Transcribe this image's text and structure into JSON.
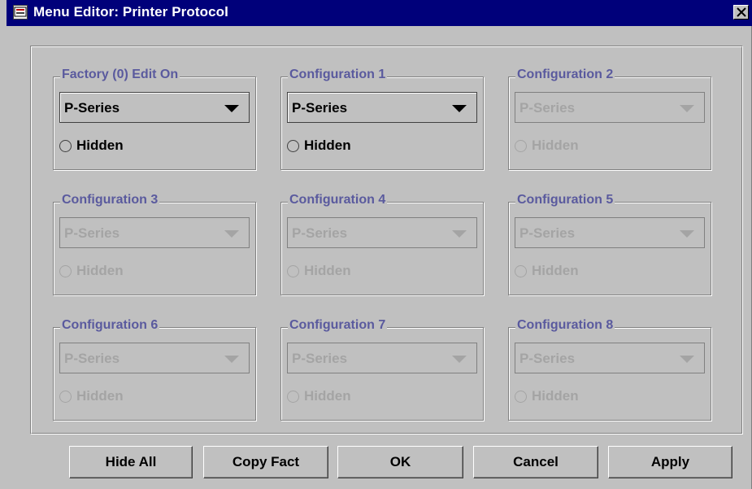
{
  "window": {
    "title": "Menu Editor: Printer Protocol"
  },
  "groups": [
    {
      "label": "Factory (0) Edit On",
      "value": "P-Series",
      "enabled": true,
      "radio_label": "Hidden"
    },
    {
      "label": "Configuration 1",
      "value": "P-Series",
      "enabled": true,
      "radio_label": "Hidden"
    },
    {
      "label": "Configuration 2",
      "value": "P-Series",
      "enabled": false,
      "radio_label": "Hidden"
    },
    {
      "label": "Configuration 3",
      "value": "P-Series",
      "enabled": false,
      "radio_label": "Hidden"
    },
    {
      "label": "Configuration 4",
      "value": "P-Series",
      "enabled": false,
      "radio_label": "Hidden"
    },
    {
      "label": "Configuration 5",
      "value": "P-Series",
      "enabled": false,
      "radio_label": "Hidden"
    },
    {
      "label": "Configuration 6",
      "value": "P-Series",
      "enabled": false,
      "radio_label": "Hidden"
    },
    {
      "label": "Configuration 7",
      "value": "P-Series",
      "enabled": false,
      "radio_label": "Hidden"
    },
    {
      "label": "Configuration 8",
      "value": "P-Series",
      "enabled": false,
      "radio_label": "Hidden"
    }
  ],
  "buttons": {
    "hide_all": "Hide All",
    "copy_fact": "Copy Fact",
    "ok": "OK",
    "cancel": "Cancel",
    "apply": "Apply"
  },
  "colors": {
    "titlebar": "#00007a",
    "group_label": "#5a5a9e",
    "disabled_text": "#a4a4a4",
    "background": "#c0c0c0"
  },
  "icons": {
    "window_icon": "app-window-icon",
    "close": "close-icon",
    "combo_arrow": "chevron-down-icon"
  }
}
